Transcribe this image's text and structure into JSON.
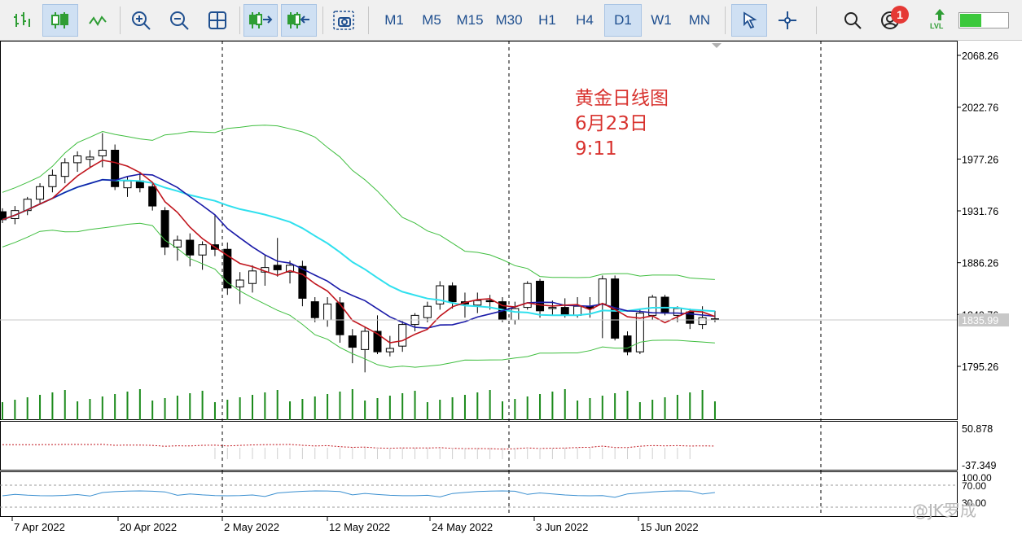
{
  "toolbar": {
    "timeframes": [
      "M1",
      "M5",
      "M15",
      "M30",
      "H1",
      "H4",
      "D1",
      "W1",
      "MN"
    ],
    "active_timeframe": "D1",
    "notification_count": "1",
    "level_label": "LVL",
    "level_fill": 0.45
  },
  "annotation": {
    "title": "黄金日线图",
    "date": "6月23日",
    "time": "9:11"
  },
  "price_axis": {
    "labels": [
      "2068.26",
      "2022.76",
      "1977.26",
      "1931.76",
      "1886.26",
      "1840.76",
      "1795.26"
    ],
    "current_price": "1835.99"
  },
  "osc1_axis": {
    "labels": [
      "50.878",
      "-37.349"
    ]
  },
  "osc2_axis": {
    "labels": [
      "100.00",
      "70.00",
      "30.00"
    ]
  },
  "date_axis": {
    "labels": [
      "7 Apr 2022",
      "20 Apr 2022",
      "2 May 2022",
      "12 May 2022",
      "24 May 2022",
      "3 Jun 2022",
      "15 Jun 2022"
    ]
  },
  "watermark": "@JK罗成",
  "colors": {
    "bull": "#ffffff",
    "bear": "#000000",
    "ma_fast": "#c0141c",
    "ma_mid": "#1a1aa8",
    "ma_slow": "#30e0ee",
    "bands": "#3fbe3f",
    "volume": "#1b8a1b",
    "annotation": "#d8322e"
  },
  "chart_data": {
    "type": "candlestick",
    "price_range": [
      1770,
      2080
    ],
    "candles": [
      [
        1931,
        1934,
        1921,
        1924
      ],
      [
        1925,
        1936,
        1920,
        1932
      ],
      [
        1932,
        1944,
        1928,
        1942
      ],
      [
        1942,
        1956,
        1938,
        1953
      ],
      [
        1953,
        1968,
        1948,
        1963
      ],
      [
        1962,
        1978,
        1956,
        1974
      ],
      [
        1974,
        1984,
        1966,
        1980
      ],
      [
        1977,
        1985,
        1970,
        1979
      ],
      [
        1980,
        2000,
        1970,
        1985
      ],
      [
        1985,
        1990,
        1950,
        1953
      ],
      [
        1952,
        1962,
        1944,
        1958
      ],
      [
        1958,
        1966,
        1948,
        1952
      ],
      [
        1953,
        1956,
        1932,
        1936
      ],
      [
        1932,
        1935,
        1893,
        1900
      ],
      [
        1900,
        1910,
        1888,
        1906
      ],
      [
        1906,
        1912,
        1883,
        1893
      ],
      [
        1893,
        1905,
        1880,
        1902
      ],
      [
        1902,
        1928,
        1892,
        1898
      ],
      [
        1898,
        1904,
        1858,
        1864
      ],
      [
        1865,
        1878,
        1850,
        1871
      ],
      [
        1868,
        1884,
        1860,
        1879
      ],
      [
        1878,
        1893,
        1866,
        1882
      ],
      [
        1884,
        1908,
        1874,
        1880
      ],
      [
        1878,
        1888,
        1868,
        1884
      ],
      [
        1883,
        1888,
        1848,
        1855
      ],
      [
        1852,
        1856,
        1834,
        1838
      ],
      [
        1836,
        1856,
        1830,
        1850
      ],
      [
        1851,
        1856,
        1816,
        1823
      ],
      [
        1822,
        1828,
        1798,
        1812
      ],
      [
        1810,
        1830,
        1790,
        1826
      ],
      [
        1826,
        1840,
        1806,
        1808
      ],
      [
        1808,
        1822,
        1804,
        1811
      ],
      [
        1813,
        1835,
        1808,
        1832
      ],
      [
        1832,
        1842,
        1826,
        1840
      ],
      [
        1838,
        1852,
        1834,
        1848
      ],
      [
        1850,
        1870,
        1845,
        1866
      ],
      [
        1866,
        1869,
        1846,
        1852
      ],
      [
        1852,
        1860,
        1838,
        1850
      ],
      [
        1849,
        1860,
        1842,
        1853
      ],
      [
        1853,
        1858,
        1845,
        1852
      ],
      [
        1852,
        1856,
        1834,
        1836
      ],
      [
        1836,
        1852,
        1832,
        1846
      ],
      [
        1847,
        1870,
        1845,
        1868
      ],
      [
        1870,
        1872,
        1838,
        1844
      ],
      [
        1846,
        1853,
        1840,
        1847
      ],
      [
        1847,
        1855,
        1838,
        1840
      ],
      [
        1840,
        1856,
        1838,
        1848
      ],
      [
        1848,
        1856,
        1838,
        1846
      ],
      [
        1850,
        1875,
        1820,
        1872
      ],
      [
        1872,
        1875,
        1818,
        1820
      ],
      [
        1822,
        1826,
        1805,
        1808
      ],
      [
        1808,
        1845,
        1806,
        1842
      ],
      [
        1840,
        1858,
        1836,
        1856
      ],
      [
        1856,
        1858,
        1840,
        1842
      ],
      [
        1840,
        1848,
        1834,
        1846
      ],
      [
        1843,
        1846,
        1828,
        1833
      ],
      [
        1832,
        1848,
        1828,
        1838
      ],
      [
        1837,
        1844,
        1834,
        1836
      ]
    ]
  }
}
